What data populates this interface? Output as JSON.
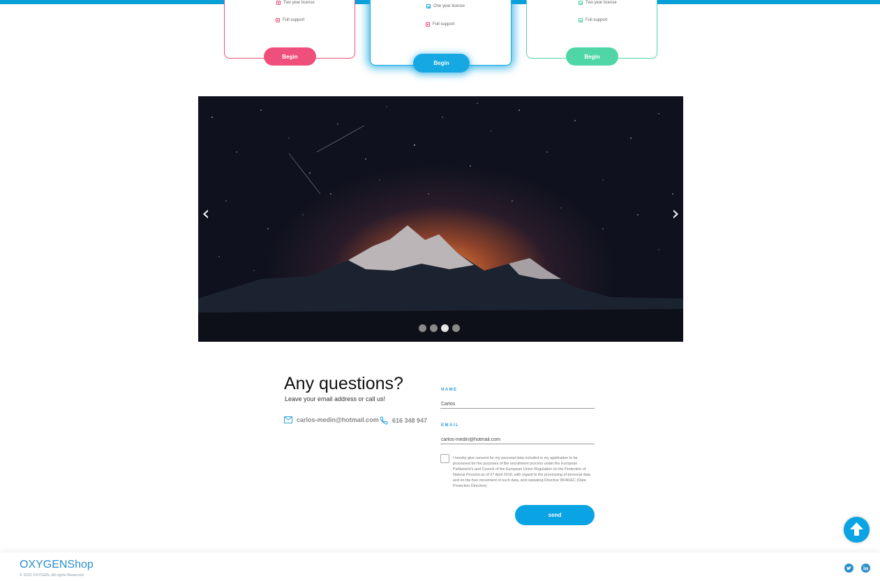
{
  "pricing": {
    "cards": [
      {
        "features": [
          "Two year license",
          "Full support"
        ],
        "button": "Begin"
      },
      {
        "features": [
          "One year license",
          "Full support"
        ],
        "button": "Begin"
      },
      {
        "features": [
          "Two year license",
          "Full support"
        ],
        "button": "Begin"
      }
    ]
  },
  "carousel": {
    "prev": "‹",
    "next": "›",
    "slides": 4,
    "active_slide": 3
  },
  "contact": {
    "title": "Any questions?",
    "subtitle": "Leave your email address or call us!",
    "email": "carlos-medin@hotmail.com",
    "phone": "616 348 947",
    "name_label": "NAME",
    "name_value": "Carlos",
    "email_label": "EMAIL",
    "email_value": "carlos-medin@hotmail.com",
    "consent": "I hereby give consent for my personal data included in my application to be processed for the purposes of the recruitment process under the European Parliament's and Council of the European Union Regulation on the Protection of Natural Persons as of 27 April 2016, with regard to the processing of personal data and on the free movement of such data, and repealing Directive 95/46/EC (Data Protection Directive)",
    "send": "send"
  },
  "footer": {
    "brand": "OXYGENShop",
    "copyright": "© 2022 OXYGEN, All rights Reserved"
  },
  "colors": {
    "pink": "#ef4f7b",
    "blue": "#16a8e3",
    "green": "#4fd6a7",
    "accent": "#0aa3e3"
  }
}
